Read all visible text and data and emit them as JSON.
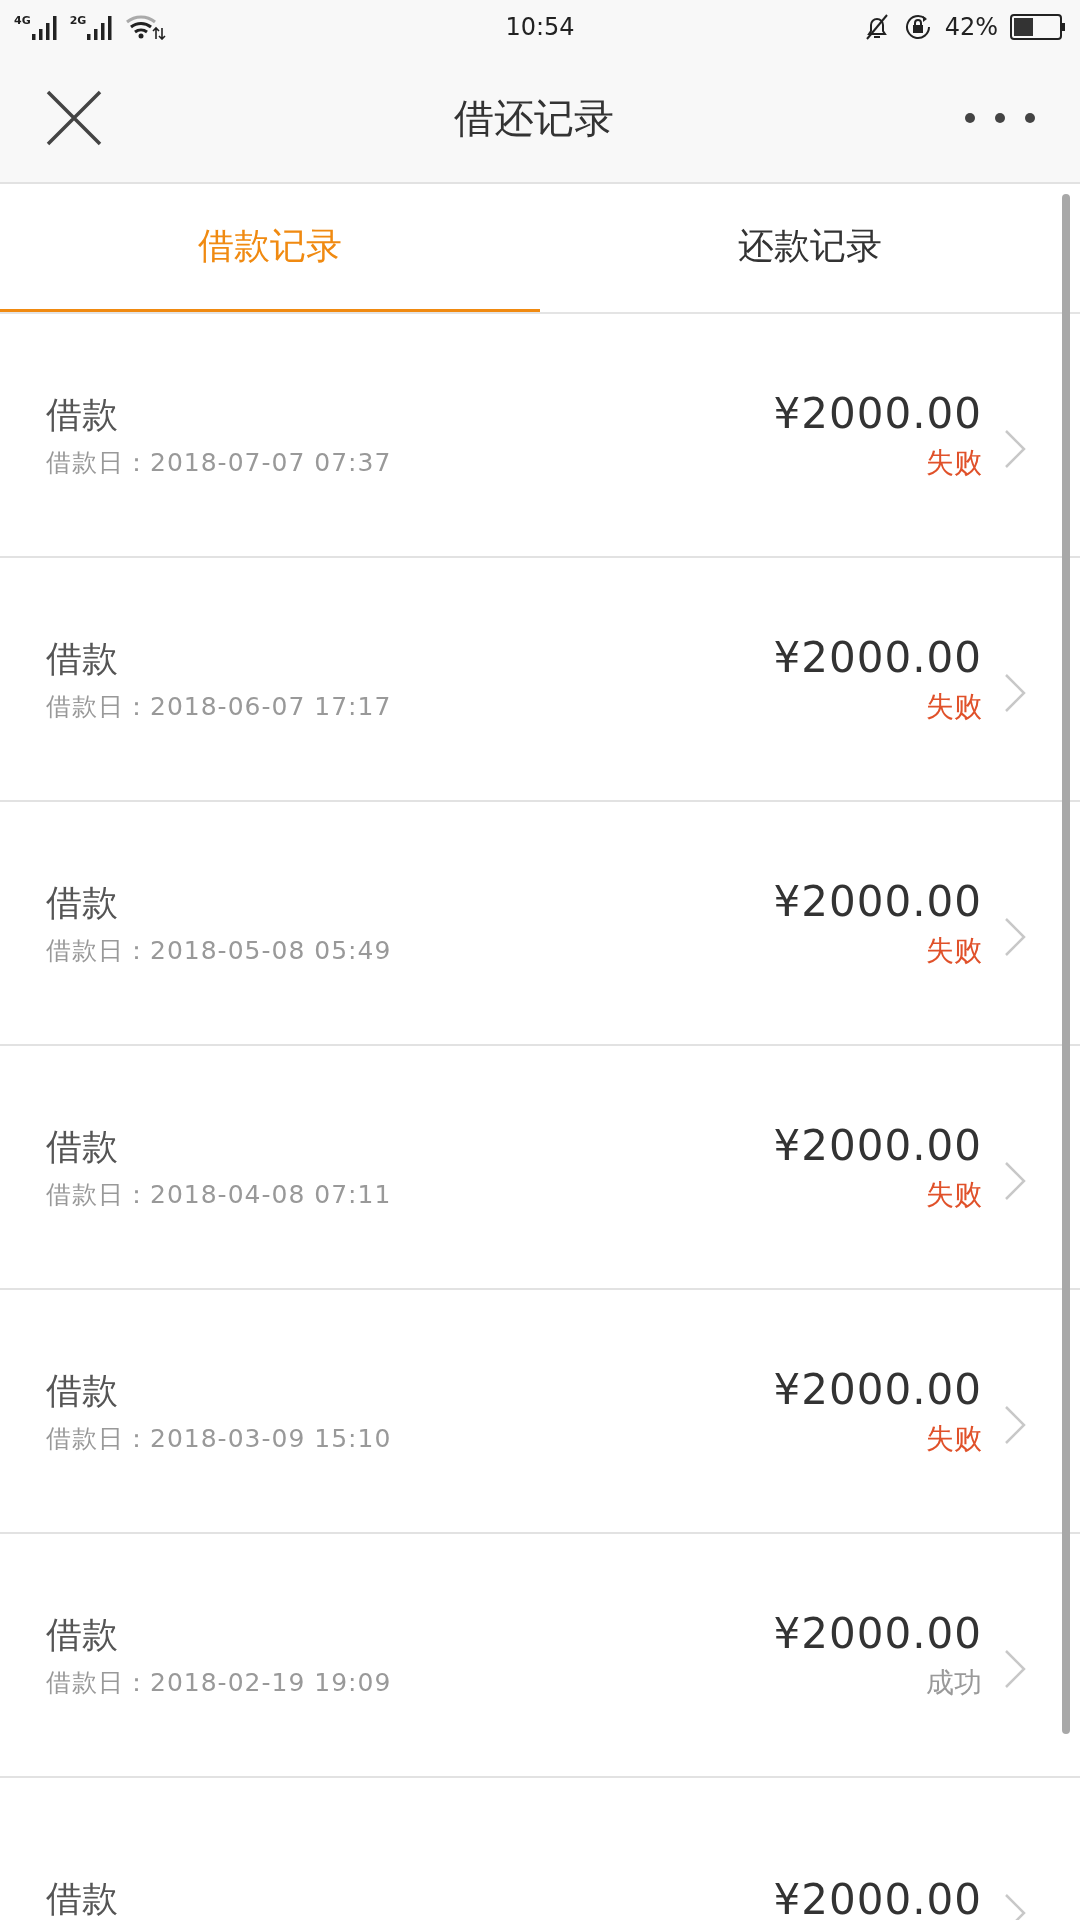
{
  "status_bar": {
    "network_1": "4G",
    "network_2": "2G",
    "time": "10:54",
    "battery": "42%"
  },
  "header": {
    "title": "借还记录"
  },
  "tabs": [
    {
      "label": "借款记录",
      "selected": true
    },
    {
      "label": "还款记录",
      "selected": false
    }
  ],
  "records": [
    {
      "type": "借款",
      "date": "借款日：2018-07-07 07:37",
      "amount": "¥2000.00",
      "status": "失败",
      "kind": "failed"
    },
    {
      "type": "借款",
      "date": "借款日：2018-06-07 17:17",
      "amount": "¥2000.00",
      "status": "失败",
      "kind": "failed"
    },
    {
      "type": "借款",
      "date": "借款日：2018-05-08 05:49",
      "amount": "¥2000.00",
      "status": "失败",
      "kind": "failed"
    },
    {
      "type": "借款",
      "date": "借款日：2018-04-08 07:11",
      "amount": "¥2000.00",
      "status": "失败",
      "kind": "failed"
    },
    {
      "type": "借款",
      "date": "借款日：2018-03-09 15:10",
      "amount": "¥2000.00",
      "status": "失败",
      "kind": "failed"
    },
    {
      "type": "借款",
      "date": "借款日：2018-02-19 19:09",
      "amount": "¥2000.00",
      "status": "成功",
      "kind": "success"
    },
    {
      "type": "借款",
      "amount": "¥2000.00"
    }
  ]
}
